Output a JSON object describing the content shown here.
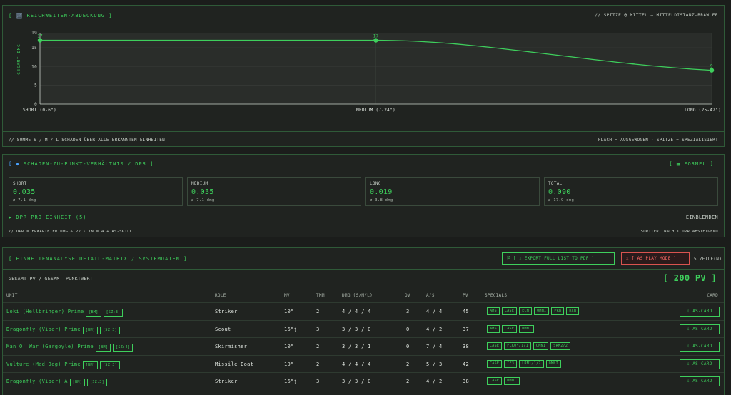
{
  "chart_panel": {
    "title": "REICHWEITEN-ABDECKUNG ]",
    "title_prefix": "[",
    "subtitle": "// SPITZE @ MITTEL — MITTELDISTANZ-BRAWLER",
    "footer_left": "// SUMME S / M / L SCHADEN ÜBER ALLE ERKANNTEN EINHEITEN",
    "footer_right": "FLACH = AUSGEWOGEN · SPITZE = SPEZIALISIERT"
  },
  "chart_data": {
    "type": "line",
    "categories": [
      "SHORT (0-6\")",
      "MEDIUM (7-24\")",
      "LONG (25-42\")"
    ],
    "values": [
      17,
      17,
      9
    ],
    "ylabel": "GESAMT-DMG",
    "yticks": [
      0,
      5,
      10,
      15
    ],
    "ylim": [
      0,
      19
    ],
    "line_color": "#3ecf5c",
    "grid": true
  },
  "dpr_panel": {
    "title": "SCHADEN-ZU-PUNKT-VERHÄLTNIS / DPR ]",
    "title_prefix": "[ ◆",
    "formula_label": "[ ▦ FORMEL ]",
    "stats": [
      {
        "key": "SHORT",
        "value": "0.035",
        "sub": "ø 7.1 dmg"
      },
      {
        "key": "MEDIUM",
        "value": "0.035",
        "sub": "ø 7.1 dmg"
      },
      {
        "key": "LONG",
        "value": "0.019",
        "sub": "ø 3.8 dmg"
      },
      {
        "key": "TOTAL",
        "value": "0.090",
        "sub": "ø 17.9 dmg"
      }
    ],
    "expander_label": "▶ DPR PRO EINHEIT (5)",
    "expander_action": "EINBLENDEN",
    "footer_left": "// DPR = ERWARTETER DMG ÷ PV · TN = 4 + AS-SKILL",
    "footer_right": "SORTIERT NACH Σ DPR ABSTEIGEND"
  },
  "table_panel": {
    "title": "[ EINHEITENANALYSE DETAIL-MATRIX / SYSTEMDATEN ]",
    "export_button": "[ ⇩ EXPORT FULL LIST TO PDF ]",
    "play_button": "[ AS PLAY MODE ]",
    "row_count": "5 ZEILE(N)",
    "total_label": "GESAMT PV / GESAMT-PUNKTWERT",
    "total_value": "[ 200 PV ]",
    "columns": [
      "UNIT",
      "ROLE",
      "MV",
      "TMM",
      "DMG (S/M/L)",
      "OV",
      "A/S",
      "PV",
      "SPECIALS",
      "CARD"
    ],
    "card_label": "AS-CARD",
    "rows": [
      {
        "unit": "Loki (Hellbringer) Prime",
        "tags": [
          "[BM]",
          "[SZ:3]"
        ],
        "role": "Striker",
        "mv": "10\"",
        "tmm": "2",
        "dmg": "4 / 4 / 4",
        "ov": "3",
        "as": "4 / 4",
        "pv": "45",
        "specials": [
          "AMS",
          "CASE",
          "ECM",
          "OMNI",
          "PRB",
          "RCN"
        ]
      },
      {
        "unit": "Dragonfly (Viper) Prime",
        "tags": [
          "[BM]",
          "[SZ:3]"
        ],
        "role": "Scout",
        "mv": "16\"j",
        "tmm": "3",
        "dmg": "3 / 3 / 0",
        "ov": "0",
        "as": "4 / 2",
        "pv": "37",
        "specials": [
          "AMS",
          "CASE",
          "OMNI"
        ]
      },
      {
        "unit": "Man O' War (Gargoyle) Prime",
        "tags": [
          "[BM]",
          "[SZ:4]"
        ],
        "role": "Skirmisher",
        "mv": "10\"",
        "tmm": "2",
        "dmg": "3 / 3 / 1",
        "ov": "0",
        "as": "7 / 4",
        "pv": "38",
        "specials": [
          "CASE",
          "FLK0*/1/1",
          "OMNI",
          "SRM2/2"
        ]
      },
      {
        "unit": "Vulture (Mad Dog) Prime",
        "tags": [
          "[BM]",
          "[SZ:3]"
        ],
        "role": "Missile Boat",
        "mv": "10\"",
        "tmm": "2",
        "dmg": "4 / 4 / 4",
        "ov": "2",
        "as": "5 / 3",
        "pv": "42",
        "specials": [
          "CASE",
          "IF3",
          "LRM1/1/2",
          "OMNI"
        ]
      },
      {
        "unit": "Dragonfly (Viper) A",
        "tags": [
          "[BM]",
          "[SZ:3]"
        ],
        "role": "Striker",
        "mv": "16\"j",
        "tmm": "3",
        "dmg": "3 / 3 / 0",
        "ov": "2",
        "as": "4 / 2",
        "pv": "38",
        "specials": [
          "CASE",
          "OMNI"
        ]
      }
    ]
  }
}
